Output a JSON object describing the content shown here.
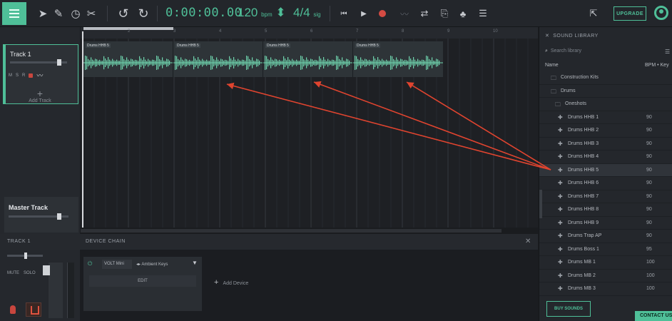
{
  "toolbar": {
    "time": "0:00:00.00",
    "bpm": "120",
    "bpm_unit": "bpm",
    "bpm_arrows": "⬍",
    "time_signature": "4/4",
    "sig_unit": "sig",
    "upgrade_label": "UPGRADE",
    "icons": [
      "menu-icon",
      "pointer-icon",
      "pencil-icon",
      "metronome-icon",
      "scissors-icon",
      "undo-icon",
      "redo-icon",
      "skip-back-icon",
      "play-icon",
      "record-icon",
      "automation-icon",
      "loop-icon",
      "share-icon",
      "user-icon"
    ],
    "accent": "#4fbf98"
  },
  "tracks": {
    "track1_name": "Track 1",
    "track_buttons": [
      "M",
      "S",
      "R"
    ],
    "add_track_label": "Add Track",
    "master_name": "Master Track"
  },
  "arrangement": {
    "ruler_marks": [
      "2",
      "3",
      "4",
      "5",
      "6",
      "7",
      "8",
      "9",
      "10"
    ],
    "clips": [
      "Drums HHB 5",
      "Drums HHB 5",
      "Drums HHB 5",
      "Drums HHB 5"
    ]
  },
  "library": {
    "title": "SOUND LIBRARY",
    "search_placeholder": "Search library",
    "col_name": "Name",
    "col_bpm": "BPM • Key",
    "folders": [
      "Construction Kits",
      "Drums",
      "Oneshots"
    ],
    "items": [
      {
        "name": "Drums HHB 1",
        "bpm": "90"
      },
      {
        "name": "Drums HHB 2",
        "bpm": "90"
      },
      {
        "name": "Drums HHB 3",
        "bpm": "90"
      },
      {
        "name": "Drums HHB 4",
        "bpm": "90"
      },
      {
        "name": "Drums HHB 5",
        "bpm": "90"
      },
      {
        "name": "Drums HHB 6",
        "bpm": "90"
      },
      {
        "name": "Drums HHB 7",
        "bpm": "90"
      },
      {
        "name": "Drums HHB 8",
        "bpm": "90"
      },
      {
        "name": "Drums HHB 9",
        "bpm": "90"
      },
      {
        "name": "Drums Trap AP",
        "bpm": "90"
      },
      {
        "name": "Drums Boss 1",
        "bpm": "95"
      },
      {
        "name": "Drums MB 1",
        "bpm": "100"
      },
      {
        "name": "Drums MB 2",
        "bpm": "100"
      },
      {
        "name": "Drums MB 3",
        "bpm": "100"
      }
    ],
    "buy_label": "BUY SOUNDS",
    "contact_label": "CONTACT US"
  },
  "bottom": {
    "track_label": "TRACK 1",
    "chain_label": "DEVICE CHAIN",
    "mute_label": "MUTE",
    "solo_label": "SOLO",
    "device_preset_a": "VOLT Mini",
    "device_preset_b": "Ambient Keys",
    "edit_label": "EDIT",
    "add_device_label": "Add Device"
  }
}
